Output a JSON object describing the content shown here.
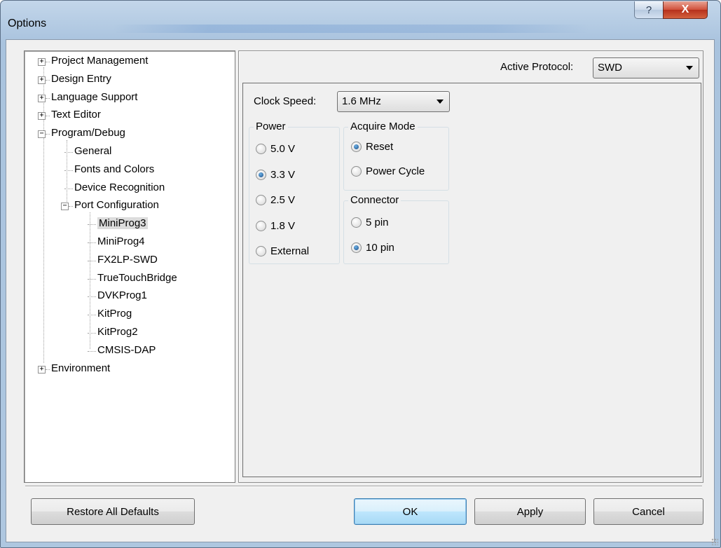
{
  "window": {
    "title": "Options",
    "help_glyph": "?",
    "close_glyph": "X"
  },
  "tree": {
    "items": [
      {
        "label": "Project Management",
        "expander": "+"
      },
      {
        "label": "Design Entry",
        "expander": "+"
      },
      {
        "label": "Language Support",
        "expander": "+"
      },
      {
        "label": "Text Editor",
        "expander": "+"
      },
      {
        "label": "Program/Debug",
        "expander": "−"
      },
      {
        "label": "General"
      },
      {
        "label": "Fonts and Colors"
      },
      {
        "label": "Device Recognition"
      },
      {
        "label": "Port Configuration",
        "expander": "−"
      },
      {
        "label": "MiniProg3",
        "selected": true
      },
      {
        "label": "MiniProg4"
      },
      {
        "label": "FX2LP-SWD"
      },
      {
        "label": "TrueTouchBridge"
      },
      {
        "label": "DVKProg1"
      },
      {
        "label": "KitProg"
      },
      {
        "label": "KitProg2"
      },
      {
        "label": "CMSIS-DAP"
      },
      {
        "label": "Environment",
        "expander": "+"
      }
    ]
  },
  "settings": {
    "active_protocol_label": "Active Protocol:",
    "active_protocol_value": "SWD",
    "clock_speed_label": "Clock Speed:",
    "clock_speed_value": "1.6 MHz",
    "power": {
      "title": "Power",
      "options": [
        {
          "label": "5.0 V",
          "checked": false
        },
        {
          "label": "3.3 V",
          "checked": true
        },
        {
          "label": "2.5 V",
          "checked": false
        },
        {
          "label": "1.8 V",
          "checked": false
        },
        {
          "label": "External",
          "checked": false
        }
      ]
    },
    "acquire_mode": {
      "title": "Acquire Mode",
      "options": [
        {
          "label": "Reset",
          "checked": true
        },
        {
          "label": "Power Cycle",
          "checked": false
        }
      ]
    },
    "connector": {
      "title": "Connector",
      "options": [
        {
          "label": "5 pin",
          "checked": false
        },
        {
          "label": "10 pin",
          "checked": true
        }
      ]
    }
  },
  "buttons": {
    "restore": "Restore All Defaults",
    "ok": "OK",
    "apply": "Apply",
    "cancel": "Cancel"
  }
}
